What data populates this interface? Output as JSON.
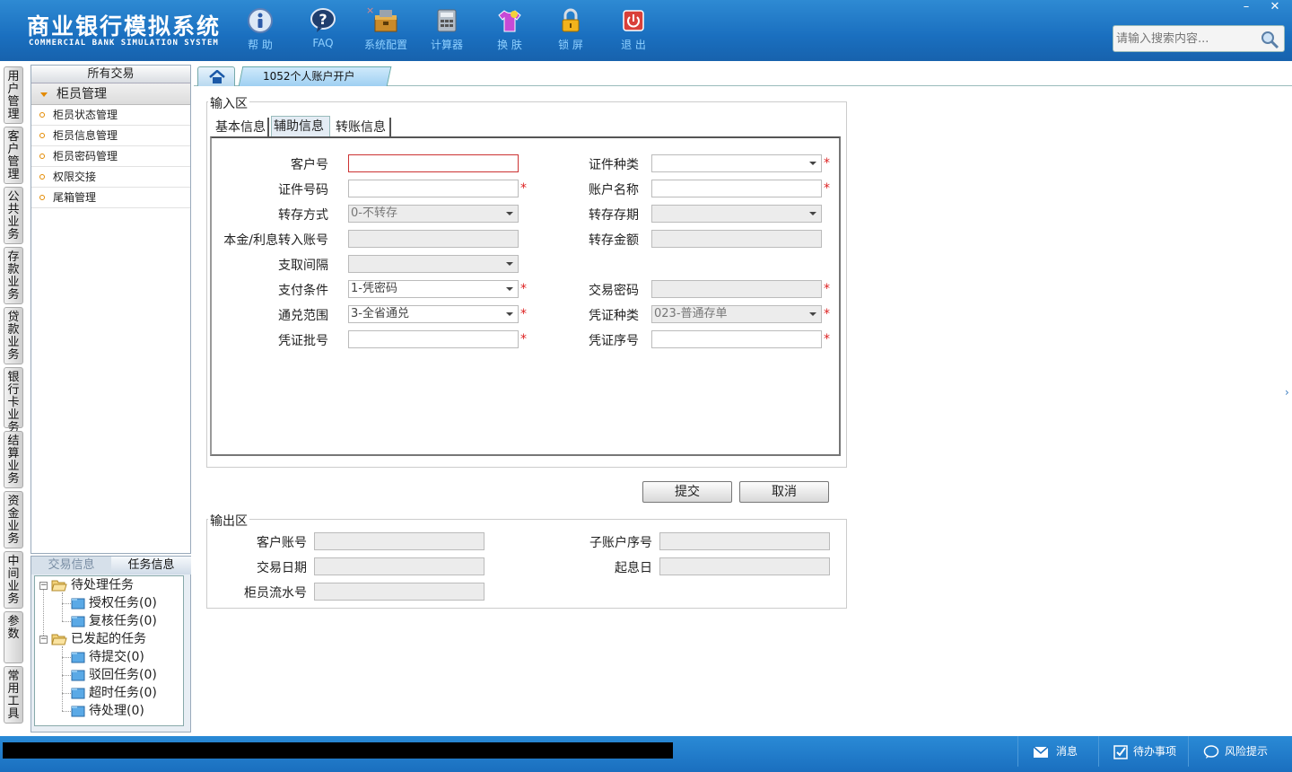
{
  "header": {
    "title_cn": "商业银行模拟系统",
    "title_en": "COMMERCIAL BANK SIMULATION SYSTEM",
    "toolbar": [
      {
        "label": "帮 助",
        "icon": "help-icon"
      },
      {
        "label": "FAQ",
        "icon": "faq-icon"
      },
      {
        "label": "系统配置",
        "icon": "toolbox-icon"
      },
      {
        "label": "计算器",
        "icon": "calculator-icon"
      },
      {
        "label": "换 肤",
        "icon": "tshirt-icon"
      },
      {
        "label": "锁 屏",
        "icon": "lock-icon"
      },
      {
        "label": "退 出",
        "icon": "power-icon"
      }
    ],
    "search_placeholder": "请输入搜索内容...",
    "window_controls": {
      "minimize": "–",
      "close": "✕"
    }
  },
  "left_tabs": [
    "用户管理",
    "客户管理",
    "公共业务",
    "存款业务",
    "贷款业务",
    "银行卡业务",
    "结算业务",
    "资金业务",
    "中间业务",
    "参数",
    "常用工具"
  ],
  "sidebar": {
    "header": "所有交易",
    "group": "柜员管理",
    "items": [
      "柜员状态管理",
      "柜员信息管理",
      "柜员密码管理",
      "权限交接",
      "尾箱管理"
    ]
  },
  "task_panel": {
    "tabs": [
      "交易信息",
      "任务信息"
    ],
    "tree": {
      "pending": {
        "label": "待处理任务",
        "children": [
          "授权任务(0)",
          "复核任务(0)"
        ]
      },
      "initiated": {
        "label": "已发起的任务",
        "children": [
          "待提交(0)",
          "驳回任务(0)",
          "超时任务(0)",
          "待处理(0)"
        ]
      }
    }
  },
  "tabs": {
    "active": "1052个人账户开户",
    "close": "×"
  },
  "input_area": {
    "legend": "输入区",
    "subtabs": [
      "基本信息",
      "辅助信息",
      "转账信息"
    ],
    "fields": {
      "customer_no": {
        "label": "客户号",
        "value": ""
      },
      "id_type": {
        "label": "证件种类",
        "value": ""
      },
      "id_no": {
        "label": "证件号码",
        "value": ""
      },
      "account_name": {
        "label": "账户名称",
        "value": ""
      },
      "rollover_method": {
        "label": "转存方式",
        "value": "0-不转存"
      },
      "rollover_term": {
        "label": "转存存期",
        "value": ""
      },
      "principal_account": {
        "label": "本金/利息转入账号",
        "value": ""
      },
      "rollover_amount": {
        "label": "转存金额",
        "value": ""
      },
      "withdraw_interval": {
        "label": "支取间隔",
        "value": ""
      },
      "pay_condition": {
        "label": "支付条件",
        "value": "1-凭密码"
      },
      "trade_password": {
        "label": "交易密码",
        "value": ""
      },
      "exchange_scope": {
        "label": "通兑范围",
        "value": "3-全省通兑"
      },
      "voucher_type": {
        "label": "凭证种类",
        "value": "023-普通存单"
      },
      "voucher_batch": {
        "label": "凭证批号",
        "value": ""
      },
      "voucher_seq": {
        "label": "凭证序号",
        "value": ""
      }
    },
    "required_mark": "*"
  },
  "actions": {
    "submit": "提交",
    "cancel": "取消"
  },
  "output_area": {
    "legend": "输出区",
    "fields": {
      "customer_account": {
        "label": "客户账号",
        "value": ""
      },
      "sub_account_seq": {
        "label": "子账户序号",
        "value": ""
      },
      "trade_date": {
        "label": "交易日期",
        "value": ""
      },
      "value_date": {
        "label": "起息日",
        "value": ""
      },
      "teller_serial": {
        "label": "柜员流水号",
        "value": ""
      }
    }
  },
  "status_bar": {
    "message": "消息",
    "todo": "待办事项",
    "risk": "风险提示"
  },
  "colors": {
    "header_blue": "#1a6fbf",
    "toolbar_text": "#8fd0ff",
    "required_red": "#d22222",
    "accent_orange": "#e38a00"
  }
}
